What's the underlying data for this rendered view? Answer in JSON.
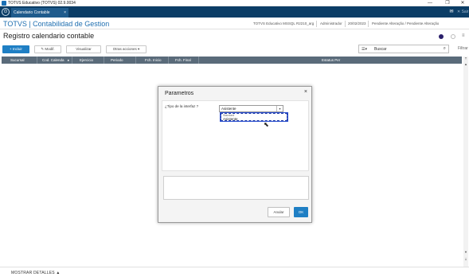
{
  "window": {
    "title": "TOTVS Educativo (TOTVS) 02.9.0034",
    "minimize": "—",
    "restore": "❐",
    "close": "✕"
  },
  "tabs": [
    {
      "label": "Calendario Contable [02.9.0034]",
      "close": "×"
    }
  ],
  "tabbar": {
    "sair": "✕ Sair"
  },
  "module": {
    "title": "TOTVS | Contabilidad de Gestion",
    "env": "TOTVS Educativo MSSQL R2210_arg",
    "user": "Administrador",
    "date": "20/02/2023",
    "pending": "Pendiente Alteração / Pendiente Alteração"
  },
  "page": {
    "title": "Registro calendario contable"
  },
  "toolbar": {
    "include": "+ Incluir",
    "modify": "✎ Modif.",
    "view": "Visualizar",
    "other": "Otras acciones",
    "other_caret": "▾"
  },
  "search": {
    "placeholder": "Buscar",
    "filter": "Filtrar"
  },
  "table": {
    "columns": [
      "Sucursal",
      "Cod. Calenda",
      "Ejercicio",
      "Periodo",
      "Fch. Inicio",
      "Fch. Final",
      "Estatus Per"
    ]
  },
  "footer": {
    "details": "MOSTRAR DETALLES ▲"
  },
  "dialog": {
    "title": "Parametros",
    "close": "×",
    "field_label": "¿Tipo de la interfaz ?",
    "select_value": "Asistente",
    "options": [
      "Standard",
      "Asistente"
    ],
    "cancel": "Anular",
    "ok": "OK"
  },
  "colors": {
    "accent": "#1f7fc4",
    "header_dark": "#0b3d66",
    "table_header": "#5a6b7a"
  }
}
